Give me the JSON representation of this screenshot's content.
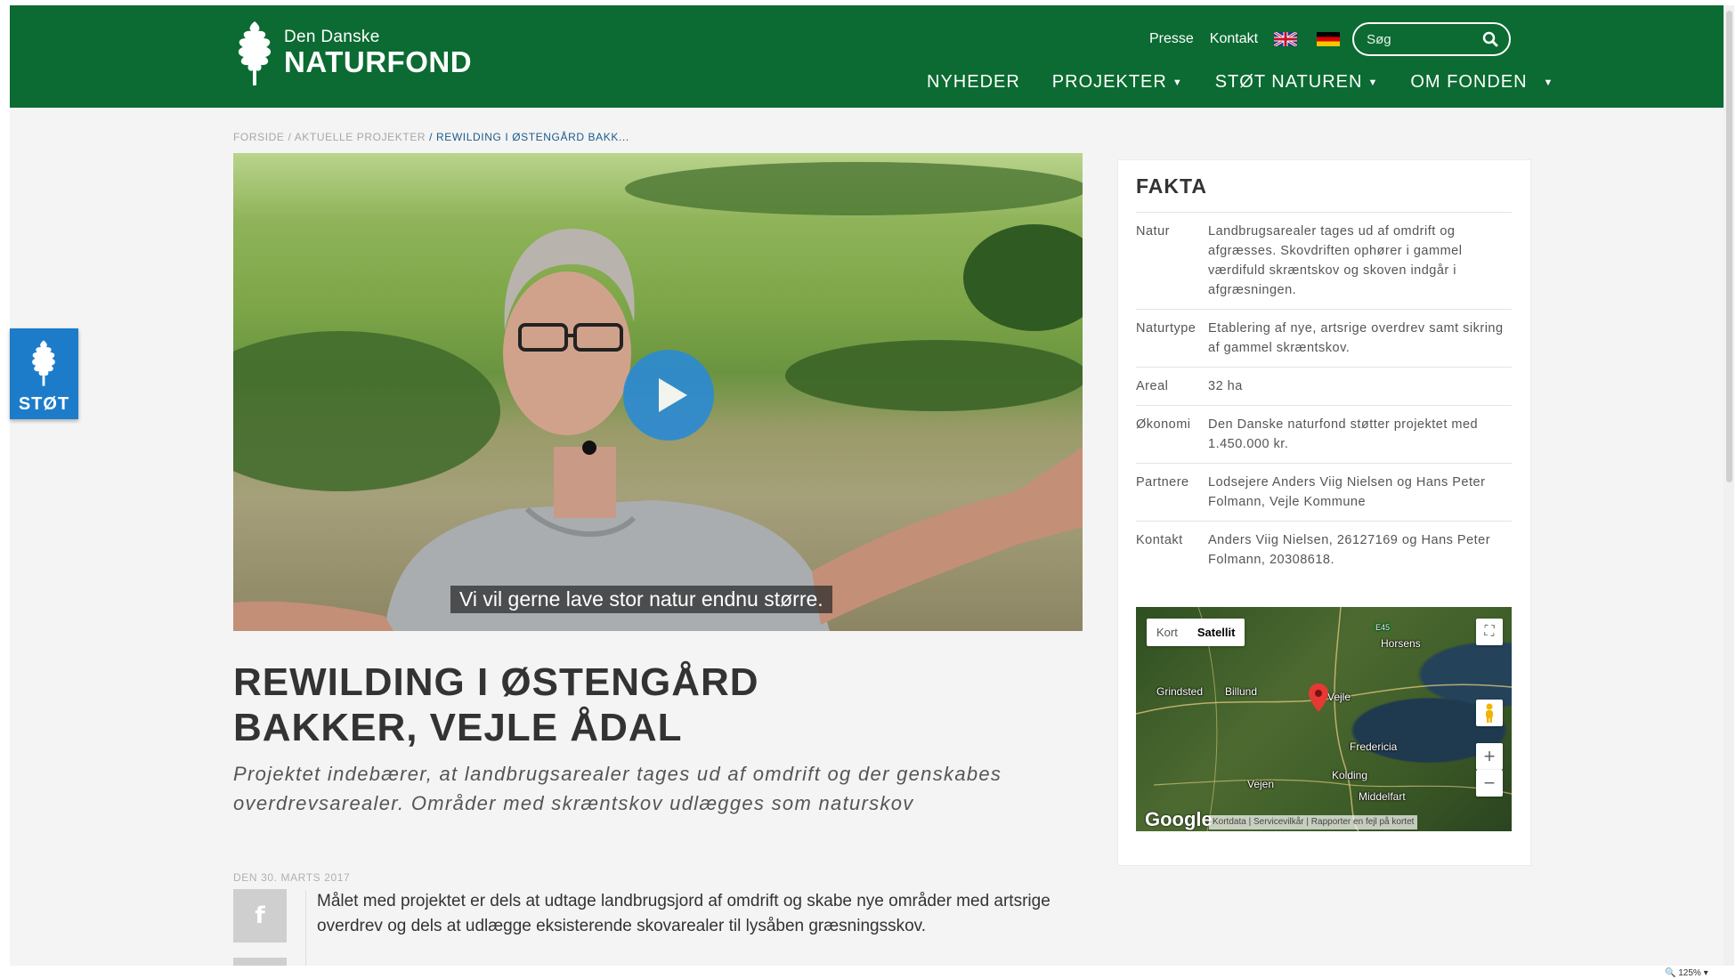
{
  "header": {
    "logo_small": "Den Danske",
    "logo_big": "NATURFOND",
    "util_links": [
      "Presse",
      "Kontakt"
    ],
    "search_placeholder": "Søg",
    "nav": [
      "NYHEDER",
      "PROJEKTER",
      "STØT NATUREN",
      "OM FONDEN"
    ]
  },
  "breadcrumb": {
    "home": "FORSIDE",
    "parent": "/ AKTUELLE PROJEKTER",
    "current": "/ REWILDING I ØSTENGÅRD BAKK..."
  },
  "video": {
    "caption": "Vi vil gerne lave stor natur endnu større."
  },
  "article": {
    "title": "REWILDING I ØSTENGÅRD BAKKER, VEJLE ÅDAL",
    "lead": "Projektet indebærer, at landbrugsarealer tages ud af omdrift og der genskabes overdrevsarealer. Områder med skræntskov udlægges som naturskov",
    "date": "DEN 30. MARTS 2017",
    "body": "Målet med projektet er dels at udtage landbrugsjord af omdrift og skabe nye områder med artsrige overdrev og dels at udlægge eksisterende skovarealer til lysåben græsningsskov."
  },
  "fakta": {
    "heading": "FAKTA",
    "rows": [
      {
        "key": "Natur",
        "value": "Landbrugsarealer tages ud af omdrift og afgræsses. Skovdriften ophører i gammel værdifuld skræntskov og skoven indgår i afgræsningen."
      },
      {
        "key": "Naturtype",
        "value": "Etablering af nye, artsrige overdrev samt sikring af gammel skræntskov."
      },
      {
        "key": "Areal",
        "value": "32 ha"
      },
      {
        "key": "Økonomi",
        "value": "Den Danske naturfond støtter projektet med 1.450.000 kr."
      },
      {
        "key": "Partnere",
        "value": "Lodsejere Anders Viig Nielsen og Hans Peter Folmann, Vejle Kommune"
      },
      {
        "key": "Kontakt",
        "value": "Anders Viig Nielsen, 26127169 og Hans Peter Folmann, 20308618."
      }
    ]
  },
  "map": {
    "tab_map": "Kort",
    "tab_satellite": "Satellit",
    "labels": [
      "Horsens",
      "Grindsted",
      "Billund",
      "Vejle",
      "Fredericia",
      "Kolding",
      "Vejen",
      "Middelfart"
    ],
    "road_badge": "E45",
    "google": "Google",
    "footer": "Kortdata | Servicevilkår | Rapporter en fejl på kortet"
  },
  "side_tab": {
    "label": "STØT"
  },
  "browser": {
    "zoom": "125%"
  }
}
